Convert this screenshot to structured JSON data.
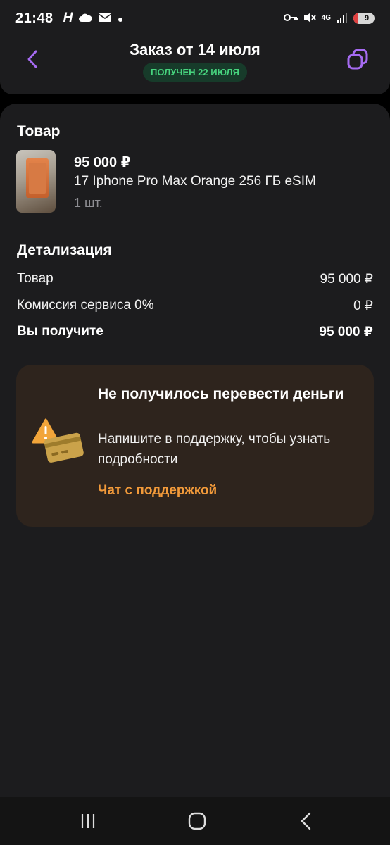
{
  "status_bar": {
    "time": "21:48",
    "network": "4G",
    "battery_level": "9",
    "icons": [
      "h-app-icon",
      "cloud-icon",
      "mail-icon",
      "dot-icon",
      "key-icon",
      "mute-icon",
      "signal-icon",
      "battery-icon"
    ]
  },
  "header": {
    "title": "Заказ от 14 июля",
    "badge": "ПОЛУЧЕН 22 ИЮЛЯ",
    "accent_color": "#a66bf2"
  },
  "product": {
    "section_title": "Товар",
    "price": "95 000 ₽",
    "name": "17 Iphone Pro Max Orange 256 ГБ eSIM",
    "quantity": "1 шт."
  },
  "details": {
    "section_title": "Детализация",
    "rows": [
      {
        "label": "Товар",
        "value": "95 000 ₽"
      },
      {
        "label": "Комиссия сервиса 0%",
        "value": "0 ₽"
      },
      {
        "label": "Вы получите",
        "value": "95 000 ₽"
      }
    ]
  },
  "alert": {
    "title": "Не получилось перевести деньги",
    "text": "Напишите в поддержку, чтобы узнать подробности",
    "link": "Чат с поддержкой",
    "link_color": "#f29a3a",
    "background_color": "#2e241d"
  },
  "navbar": {
    "icons": [
      "recent-apps-icon",
      "home-icon",
      "back-nav-icon"
    ]
  }
}
